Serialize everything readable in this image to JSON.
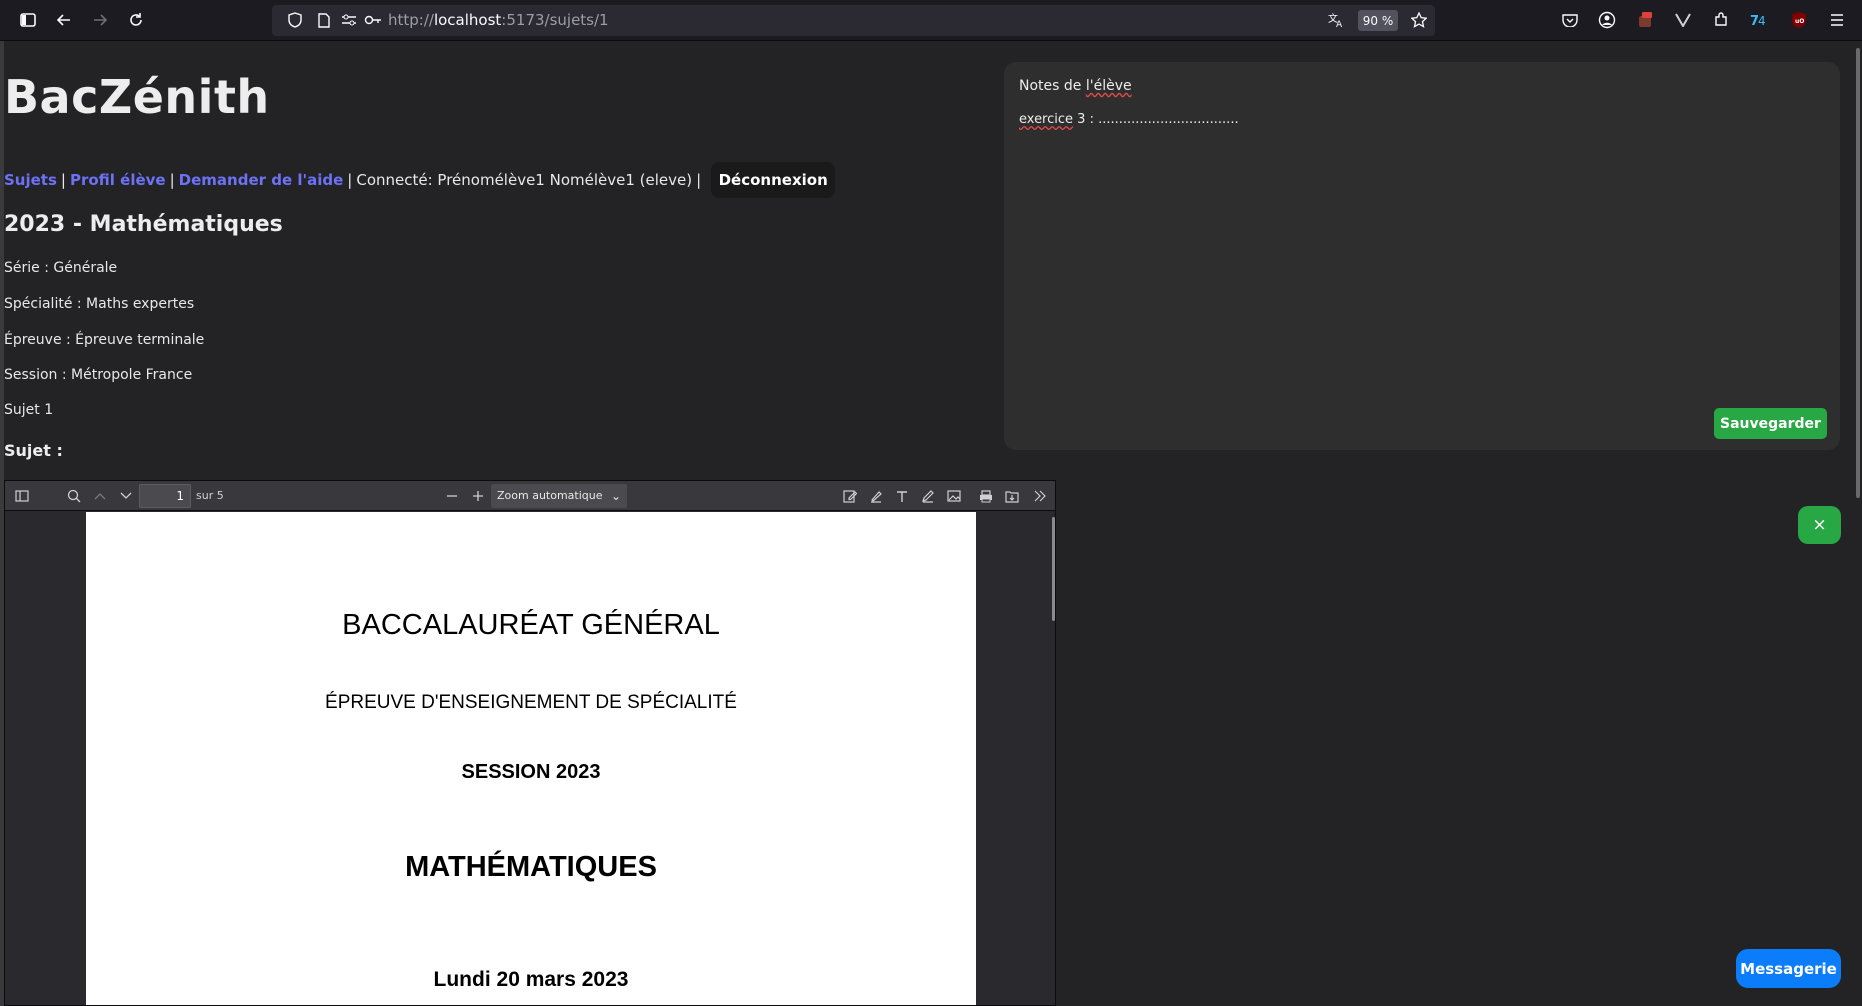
{
  "browser": {
    "url_scheme": "http://",
    "url_host": "localhost",
    "url_path": ":5173/sujets/1",
    "zoom": "90 %"
  },
  "app": {
    "title": "BacZénith"
  },
  "nav": {
    "subjects": "Sujets",
    "profile": "Profil élève",
    "help": "Demander de l'aide",
    "separator": "|",
    "connected": "Connecté: Prénomélève1 Nomélève1 (eleve)",
    "logout": "Déconnexion"
  },
  "subject": {
    "title": "2023 - Mathématiques",
    "serie": "Série : Générale",
    "specialite": "Spécialité : Maths expertes",
    "epreuve": "Épreuve : Épreuve terminale",
    "session": "Session : Métropole France",
    "sujet_num": "Sujet 1",
    "sujet_label": "Sujet :"
  },
  "pdf": {
    "page_current": "1",
    "page_total": "sur 5",
    "zoom": "Zoom automatique",
    "lines": [
      "BACCALAURÉAT GÉNÉRAL",
      "ÉPREUVE D'ENSEIGNEMENT DE SPÉCIALITÉ",
      "SESSION 2023",
      "MATHÉMATIQUES",
      "Lundi 20 mars 2023"
    ]
  },
  "notes": {
    "title_prefix": "Notes de ",
    "title_word": "l'élève",
    "text_word": "exercice",
    "text_rest": " 3 : ..................................",
    "save": "Sauvegarder"
  },
  "chat": {
    "close_icon": "×",
    "messaging": "Messagerie"
  },
  "colors": {
    "link": "#6c72f5",
    "save": "#28a745",
    "messaging": "#0b7dfa"
  }
}
